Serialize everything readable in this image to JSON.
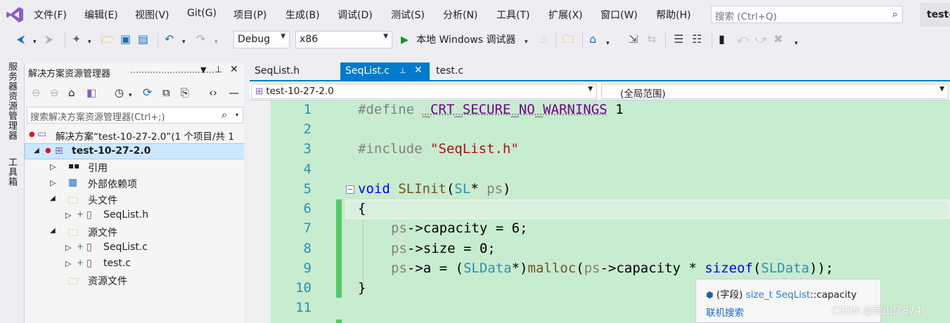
{
  "menu": [
    "文件(F)",
    "编辑(E)",
    "视图(V)",
    "Git(G)",
    "项目(P)",
    "生成(B)",
    "调试(D)",
    "测试(S)",
    "分析(N)",
    "工具(T)",
    "扩展(X)",
    "窗口(W)",
    "帮助(H)"
  ],
  "search": {
    "placeholder": "搜索 (Ctrl+Q)"
  },
  "window_title": "test-",
  "toolbar": {
    "config": "Debug",
    "platform": "x86",
    "run_label": "本地 Windows 调试器"
  },
  "side_tabs": [
    "服务器资源管理器",
    "工具箱"
  ],
  "solution_explorer": {
    "title": "解决方案资源管理器",
    "search_placeholder": "搜索解决方案资源管理器(Ctrl+;)",
    "solution_label": "解决方案“test-10-27-2.0”(1 个项目/共 1",
    "project": "test-10-27-2.0",
    "nodes": [
      "引用",
      "外部依赖项",
      "头文件",
      "SeqList.h",
      "源文件",
      "SeqList.c",
      "test.c",
      "资源文件"
    ]
  },
  "tabs": [
    "SeqList.h",
    "SeqList.c",
    "test.c"
  ],
  "nav": {
    "project": "test-10-27-2.0",
    "scope": "(全局范围)"
  },
  "line_numbers": [
    "1",
    "2",
    "3",
    "4",
    "5",
    "6",
    "7",
    "8",
    "9",
    "10",
    "11"
  ],
  "code": {
    "l1": {
      "a": "#define ",
      "b": "_CRT_SECURE_NO_WARNINGS",
      "c": " 1"
    },
    "l3": {
      "a": "#include ",
      "b": "\"SeqList.h\""
    },
    "l5": {
      "a": "void ",
      "b": "SLInit",
      "c": "(",
      "d": "SL",
      "e": "* ",
      "f": "ps",
      "g": ")"
    },
    "l6": "{",
    "l7": {
      "a": "ps",
      "b": "->capacity = 6;"
    },
    "l8": {
      "a": "ps",
      "b": "->size = 0;"
    },
    "l9": {
      "a": "ps",
      "b": "->a = (",
      "c": "SLData",
      "d": "*)",
      "e": "malloc",
      "f": "(",
      "g": "ps",
      "h": "->capacity * ",
      "i": "sizeof",
      "j": "(",
      "k": "SLData",
      "l": "));"
    },
    "l10": "}"
  },
  "tooltip": {
    "prefix": "(字段) ",
    "type": "size_t SeqList",
    "member": "::capacity",
    "link": "联机搜索"
  },
  "watermark": "CSDN @南山忆874"
}
